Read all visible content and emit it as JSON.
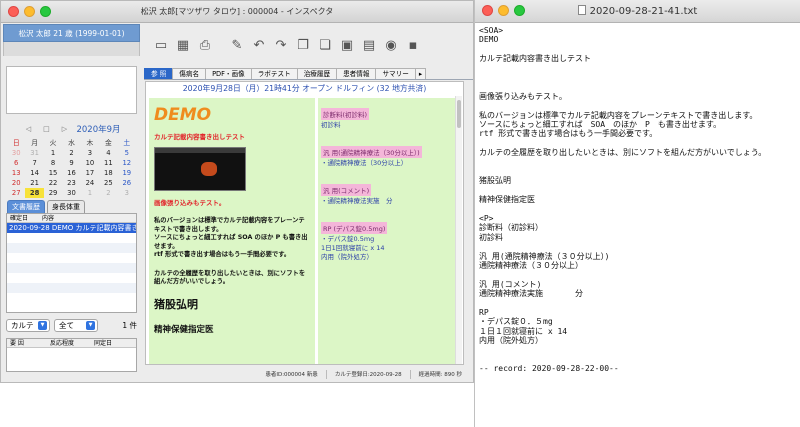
{
  "app_window": {
    "title": "松沢 太郎[マツザワ タロウ] : 000004 - インスペクタ",
    "patient_header": "松沢 太郎  21 歳 (1999-01-01)",
    "toolbar_icons": [
      "document-icon",
      "save-icon",
      "print-icon",
      "edit-icon",
      "undo-icon",
      "redo-icon",
      "copy-icon",
      "paste-icon",
      "folder-icon",
      "image-icon",
      "lock-icon",
      "flag-icon"
    ],
    "calendar": {
      "title": "2020年9月",
      "weekdays": [
        "日",
        "月",
        "火",
        "水",
        "木",
        "金",
        "土"
      ],
      "rows": [
        [
          "30",
          "31",
          "1",
          "2",
          "3",
          "4",
          "5"
        ],
        [
          "6",
          "7",
          "8",
          "9",
          "10",
          "11",
          "12"
        ],
        [
          "13",
          "14",
          "15",
          "16",
          "17",
          "18",
          "19"
        ],
        [
          "20",
          "21",
          "22",
          "23",
          "24",
          "25",
          "26"
        ],
        [
          "27",
          "28",
          "29",
          "30",
          "1",
          "2",
          "3"
        ]
      ],
      "today": "28"
    },
    "left_tabs": [
      "文書履歴",
      "身長体重"
    ],
    "record_list": {
      "headers": [
        "確定日",
        "内容"
      ],
      "rows": [
        "2020-09-28 DEMO  カルテ記載内容書き"
      ]
    },
    "filter": {
      "type": "カルテ",
      "range": "全て",
      "count": "1 件"
    },
    "alerts_headers": [
      "要 因",
      "反応程度",
      "同定日"
    ],
    "tabs": [
      "参 照",
      "傷病名",
      "PDF・画像",
      "ラボテスト",
      "治療履歴",
      "患者情報",
      "サマリー"
    ],
    "content": {
      "header": "2020年9月28日（月）21時41分 オープン ドルフィン (32 地方共済)",
      "soa": {
        "demo": "DEMO",
        "red1": "カルテ記載内容書き出しテスト",
        "red2": "画像張り込みもテスト。",
        "para1": "私のバージョンは標準でカルテ記載内容をプレーンテキストで書き出します。",
        "para1b": "ソースにちょっと細工すれば SOA のほか P も書き出せます。",
        "para1c": "rtf 形式で書き出す場合はもう一手間必要です。",
        "para2": "カルテの全履歴を取り出したいときは、別にソフトを組んだ方がいいでしょう。",
        "h1": "猪股弘明",
        "h2": "精神保健指定医"
      },
      "p": {
        "b1_title": "診断料(初診料)",
        "b1_item": "初診料",
        "b2_title": "汎 用(通院精神療法（30分以上）)",
        "b2_item": "・通院精神療法（30分以上）",
        "b3_title": "汎 用(コメント)",
        "b3_item": "・通院精神療法実施　分",
        "b4_title": "RP (デパス錠0.5mg)",
        "b4_item1": "・デパス錠0.5mg",
        "b4_item2": "1日1回就寝前に x 14",
        "b4_item3": "内用（院外処方）"
      }
    },
    "status": {
      "patient": "患者ID:000004 新患",
      "date": "カルテ登録日:2020-09-28",
      "elapsed": "経過時間: 890 秒"
    }
  },
  "text_window": {
    "title": "2020-09-28-21-41.txt",
    "lines": [
      "<SOA>",
      "DEMO",
      "",
      "カルテ記載内容書き出しテスト",
      "",
      "",
      "",
      "画像張り込みもテスト。",
      "",
      "私のバージョンは標準でカルテ記載内容をプレーンテキストで書き出します。",
      "ソースにちょっと細工すれば　SOA　のほか　P　も書き出せます。",
      "rtf 形式で書き出す場合はもう一手間必要です。",
      "",
      "カルテの全履歴を取り出したいときは、別にソフトを組んだ方がいいでしょう。",
      "",
      "",
      "猪股弘明",
      "",
      "精神保健指定医",
      "",
      "<P>",
      "診断料（初診料）",
      "初診料",
      "",
      "汎 用(通院精神療法（３０分以上）)",
      "通院精神療法（３０分以上）",
      "",
      "汎 用(コメント)",
      "通院精神療法実施　　　　分",
      "",
      "RP",
      "・デパス錠０．５mg",
      "１日１回就寝前に x 14",
      "内用（院外処方）",
      "",
      "",
      "-- record: 2020-09-28-22-00--"
    ]
  }
}
